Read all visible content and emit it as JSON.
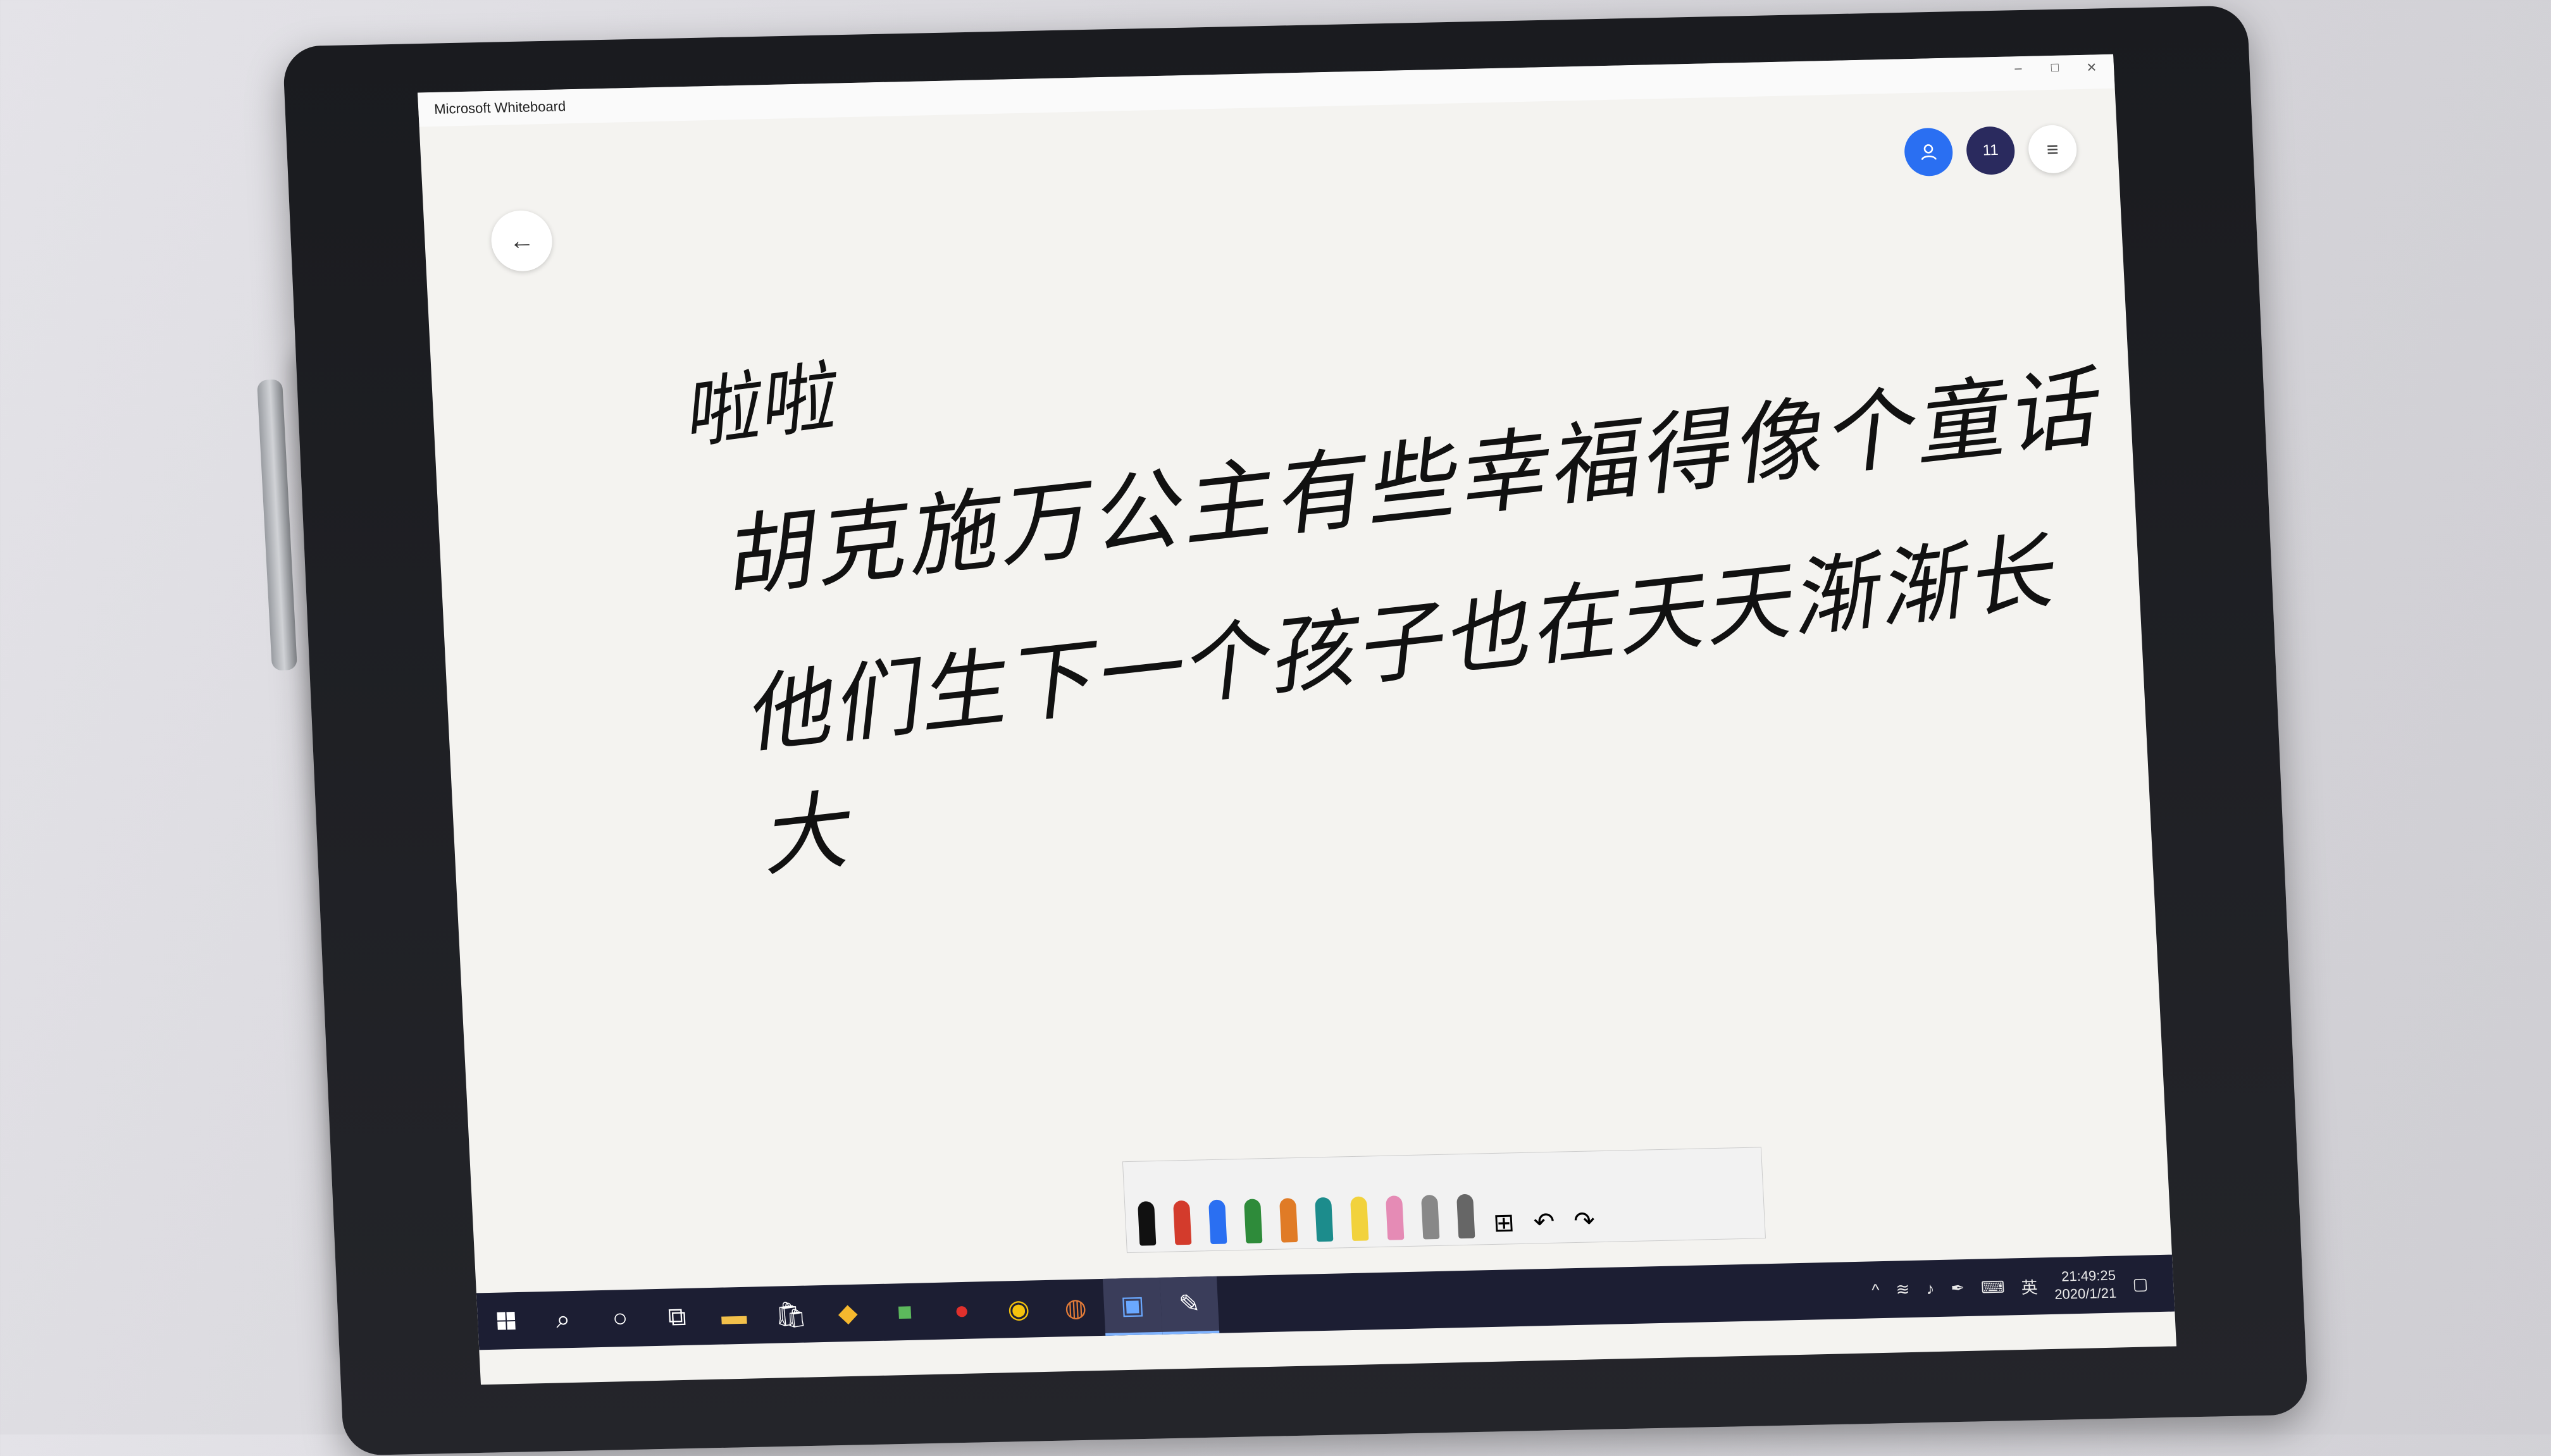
{
  "window": {
    "title": "Microsoft Whiteboard",
    "controls": [
      "–",
      "□",
      "✕"
    ]
  },
  "toolbar_top": {
    "back_icon": "←",
    "participant_count": "11",
    "user_icon": "person-icon",
    "menu_icon": "≡"
  },
  "canvas": {
    "ink_lines": [
      "啦啦",
      "胡克施万公主有些幸福得像个童话",
      "他们生下一个孩子也在天天渐渐长大",
      ""
    ]
  },
  "ink_toolbar": {
    "tools": [
      {
        "name": "black-pen",
        "color": "#111111"
      },
      {
        "name": "red-pen",
        "color": "#d33b2c"
      },
      {
        "name": "blue-pen",
        "color": "#2a6ff2"
      },
      {
        "name": "green-pen",
        "color": "#2e8b3a"
      },
      {
        "name": "orange-pen",
        "color": "#e07b26"
      },
      {
        "name": "teal-pen",
        "color": "#1c8c8c"
      },
      {
        "name": "highlighter",
        "color": "#f2d23c"
      },
      {
        "name": "eraser",
        "color": "#e58bb5"
      },
      {
        "name": "ruler",
        "color": "#888888"
      },
      {
        "name": "lasso",
        "color": "#666666"
      }
    ],
    "actions": [
      "⊞",
      "↶",
      "↷"
    ]
  },
  "taskbar": {
    "apps": [
      "start",
      "search",
      "cortana",
      "task-view",
      "file-explorer",
      "store",
      "app-yellow",
      "app-green",
      "netease-music",
      "chrome",
      "app-avatar",
      "app-blue",
      "whiteboard"
    ],
    "tray": {
      "ime": "英",
      "time": "21:49:25",
      "date": "2020/1/21"
    }
  }
}
